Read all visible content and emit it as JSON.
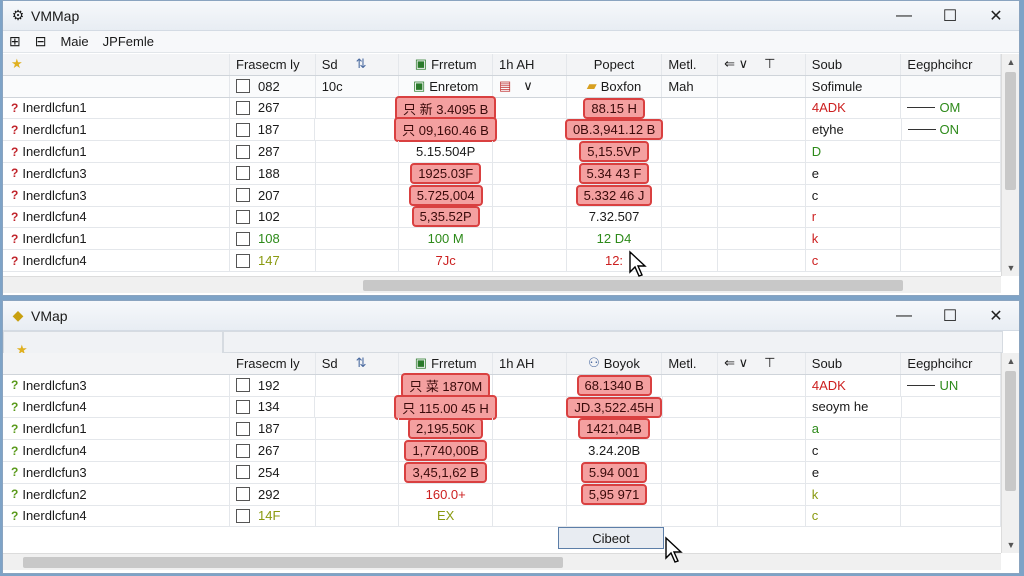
{
  "window1": {
    "title": "VMMap",
    "menu": [
      "Maie",
      "JPFemle"
    ],
    "headers": [
      "Frasecm ly",
      "Sd",
      "",
      "Frretum",
      "1h AH",
      "Popect",
      "Metl.",
      "",
      "Soub",
      "Eegphcihcr"
    ],
    "subheader": [
      "",
      "082",
      "10c",
      "Enretom",
      "",
      "Boxfon",
      "Mah",
      "",
      "Sofimule",
      ""
    ],
    "rows": [
      {
        "name": "Inerdlcfun1",
        "num": "267",
        "a": "只 新 3.4095 B",
        "b": "88.15 H",
        "s": "4ADK",
        "e": "OM",
        "a_hl": true,
        "b_hl": true,
        "a_cls": "",
        "b_cls": "",
        "s_cls": "red-txt",
        "e_cls": "green-txt"
      },
      {
        "name": "Inerdlcfun1",
        "num": "187",
        "a": "只 09,160.46 B",
        "b": "0B.3,941.12 B",
        "s": "etyhe",
        "e": "ON",
        "a_hl": true,
        "b_hl": true,
        "a_cls": "",
        "b_cls": "",
        "s_cls": "",
        "e_cls": "green-txt"
      },
      {
        "name": "Inerdlcfun1",
        "num": "287",
        "a": "5.15.504P",
        "b": "5,15.5VP",
        "s": "D",
        "e": "",
        "a_hl": false,
        "b_hl": true,
        "a_cls": "",
        "b_cls": "",
        "s_cls": "green-txt",
        "e_cls": ""
      },
      {
        "name": "Inerdlcfun3",
        "num": "188",
        "a": "1925.03F",
        "b": "5.34 43 F",
        "s": "e",
        "e": "",
        "a_hl": true,
        "b_hl": true,
        "a_cls": "",
        "b_cls": "",
        "s_cls": "",
        "e_cls": ""
      },
      {
        "name": "Inerdlcfun3",
        "num": "207",
        "a": "5.725,004",
        "b": "5.332 46 J",
        "s": "c",
        "e": "",
        "a_hl": true,
        "b_hl": true,
        "a_cls": "",
        "b_cls": "",
        "s_cls": "",
        "e_cls": ""
      },
      {
        "name": "Inerdlcfun4",
        "num": "102",
        "a": "5,35.52P",
        "b": "7.32.507",
        "s": "r",
        "e": "",
        "a_hl": true,
        "b_hl": false,
        "a_cls": "",
        "b_cls": "",
        "s_cls": "red-txt",
        "e_cls": ""
      },
      {
        "name": "Inerdlcfun1",
        "num": "108",
        "a": "100 M",
        "b": "12 D4",
        "s": "k",
        "e": "",
        "a_hl": false,
        "b_hl": false,
        "a_cls": "green-txt",
        "b_cls": "green-txt",
        "s_cls": "red-txt",
        "e_cls": "",
        "num_cls": "green-txt"
      },
      {
        "name": "Inerdlcfun4",
        "num": "147",
        "a": "7Jc",
        "b": "12:",
        "s": "c",
        "e": "",
        "a_hl": false,
        "b_hl": false,
        "a_cls": "red-txt",
        "b_cls": "red-txt",
        "s_cls": "red-txt",
        "e_cls": "",
        "num_cls": "olive-txt"
      }
    ]
  },
  "window2": {
    "title": "VMap",
    "headers": [
      "Frasecm ly",
      "Sd",
      "",
      "Frretum",
      "1h AH",
      "Boyok",
      "Metl.",
      "",
      "Soub",
      "Eegphcihcr"
    ],
    "rows": [
      {
        "name": "Inerdlcfun3",
        "num": "192",
        "a": "只 菜 1870M",
        "b": "68.1340 B",
        "s": "4ADK",
        "e": "UN",
        "a_hl": true,
        "b_hl": true,
        "a_cls": "",
        "b_cls": "",
        "s_cls": "red-txt",
        "e_cls": "green-txt"
      },
      {
        "name": "Inerdlcfun4",
        "num": "134",
        "a": "只 115.00 45 H",
        "b": "JD.3,522.45H",
        "s": "seoym he",
        "e": "",
        "a_hl": true,
        "b_hl": true,
        "a_cls": "",
        "b_cls": "",
        "s_cls": "",
        "e_cls": ""
      },
      {
        "name": "Inerdlcfun1",
        "num": "187",
        "a": "2,195,50K",
        "b": "1421,04B",
        "s": "a",
        "e": "",
        "a_hl": true,
        "b_hl": true,
        "a_cls": "",
        "b_cls": "",
        "s_cls": "green-txt",
        "e_cls": ""
      },
      {
        "name": "Inerdlcfun4",
        "num": "267",
        "a": "1,7740,00B",
        "b": "3.24.20B",
        "s": "c",
        "e": "",
        "a_hl": true,
        "b_hl": false,
        "a_cls": "",
        "b_cls": "",
        "s_cls": "",
        "e_cls": ""
      },
      {
        "name": "Inerdlcfun3",
        "num": "254",
        "a": "3,45,1,62 B",
        "b": "5.94 001",
        "s": "e",
        "e": "",
        "a_hl": true,
        "b_hl": true,
        "a_cls": "",
        "b_cls": "",
        "s_cls": "",
        "e_cls": ""
      },
      {
        "name": "Inerdlcfun2",
        "num": "292",
        "a": "160.0+",
        "b": "5,95 971",
        "s": "k",
        "e": "",
        "a_hl": false,
        "b_hl": true,
        "a_cls": "red-txt",
        "b_cls": "",
        "s_cls": "olive-txt",
        "e_cls": ""
      },
      {
        "name": "Inerdlcfun4",
        "num": "14F",
        "a": "EX",
        "b": "",
        "s": "c",
        "e": "",
        "a_hl": false,
        "b_hl": false,
        "a_cls": "olive-txt",
        "b_cls": "",
        "s_cls": "olive-txt",
        "e_cls": "",
        "num_cls": "olive-txt"
      }
    ],
    "tooltip_button": "Cibeot"
  },
  "icons": {
    "titlebar1": "vmmap-icon",
    "titlebar2": "vmmap-icon",
    "minimize": "minimize-icon",
    "maximize": "maximize-icon",
    "close": "close-icon"
  }
}
